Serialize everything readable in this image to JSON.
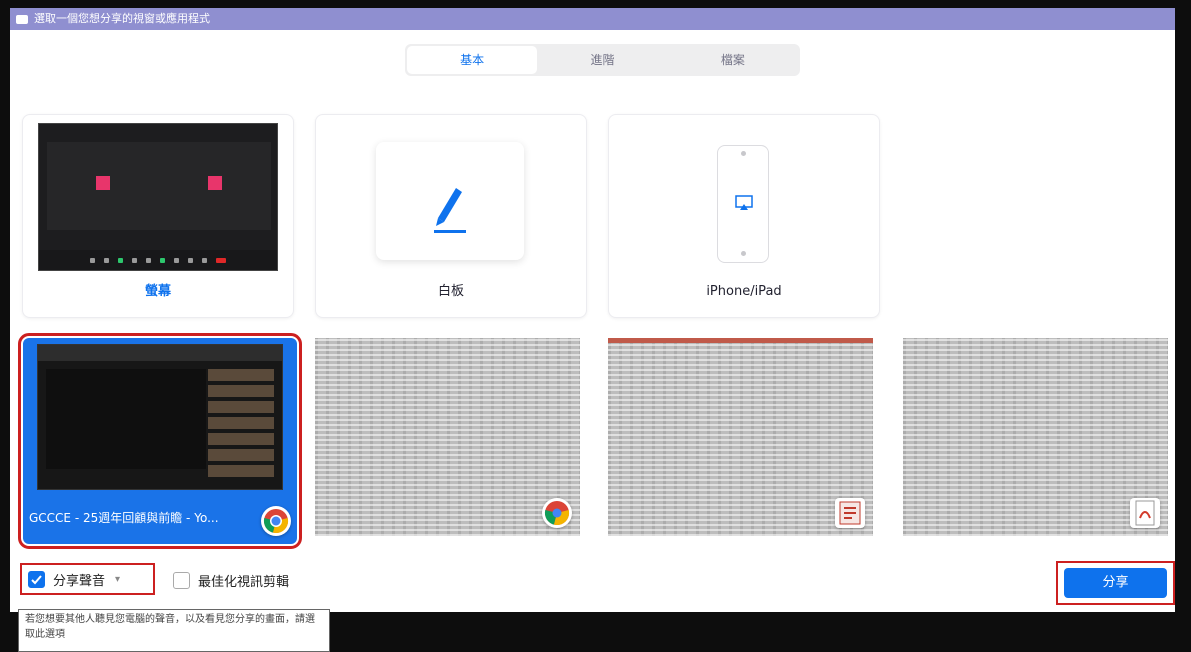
{
  "window": {
    "title": "選取一個您想分享的視窗或應用程式"
  },
  "tabs": [
    {
      "label": "基本",
      "active": true
    },
    {
      "label": "進階",
      "active": false
    },
    {
      "label": "檔案",
      "active": false
    }
  ],
  "cards": {
    "screen_label": "螢幕",
    "whiteboard_label": "白板",
    "iphone_label": "iPhone/iPad"
  },
  "windows": [
    {
      "title": "GCCCE - 25週年回顧與前瞻 - Yo...",
      "selected": true,
      "app_icon": "chrome-icon"
    },
    {
      "title": "",
      "selected": false,
      "app_icon": "chrome-icon"
    },
    {
      "title": "",
      "selected": false,
      "app_icon": "document-icon"
    },
    {
      "title": "",
      "selected": false,
      "app_icon": "pdf-icon"
    }
  ],
  "options": {
    "share_audio_label": "分享聲音",
    "share_audio_checked": true,
    "optimize_label": "最佳化視訊剪輯",
    "optimize_checked": false
  },
  "share_button": "分享",
  "tooltip": "若您想要其他人聽見您電腦的聲音，以及看見您分享的畫面，請選取此選項",
  "colors": {
    "accent": "#0e72ed",
    "highlight": "#cc2020",
    "titlebar": "#8f8fd0"
  }
}
